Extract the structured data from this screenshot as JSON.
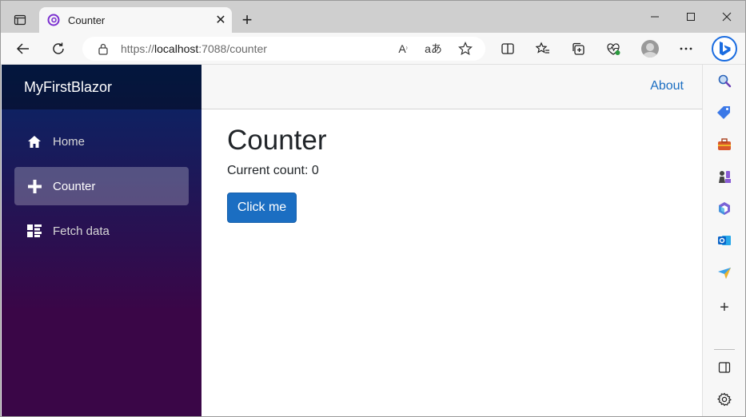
{
  "browser": {
    "tab": {
      "title": "Counter"
    },
    "address": {
      "scheme": "https://",
      "host": "localhost",
      "rest": ":7088/counter"
    },
    "colors": {
      "tabstrip": "#cfcfcf",
      "toolbar": "#f7f7f7",
      "bing": "#1a6ce0"
    },
    "toolbar_icons": [
      "back-icon",
      "refresh-icon",
      "lock-icon",
      "read-aloud-icon",
      "translate-icon",
      "favorite-star-icon",
      "split-screen-icon",
      "favorites-icon",
      "collections-icon",
      "browser-essentials-icon",
      "profile-avatar",
      "more-icon",
      "bing-copilot-icon"
    ],
    "side_panel_icons": [
      "search-icon",
      "shopping-icon",
      "tools-icon",
      "games-icon",
      "microsoft-365-icon",
      "outlook-icon",
      "drop-icon",
      "add-icon",
      "hide-sidebar-icon",
      "settings-icon"
    ]
  },
  "app": {
    "brand": "MyFirstBlazor",
    "nav": [
      {
        "label": "Home",
        "icon": "home-icon",
        "active": false
      },
      {
        "label": "Counter",
        "icon": "plus-icon",
        "active": true
      },
      {
        "label": "Fetch data",
        "icon": "list-icon",
        "active": false
      }
    ],
    "top_link": "About",
    "page_title": "Counter",
    "count_text": "Current count: 0",
    "button_label": "Click me",
    "colors": {
      "accent": "#1b6ec2",
      "sidebar_top": "#052767",
      "sidebar_bottom": "#3a0647"
    }
  }
}
